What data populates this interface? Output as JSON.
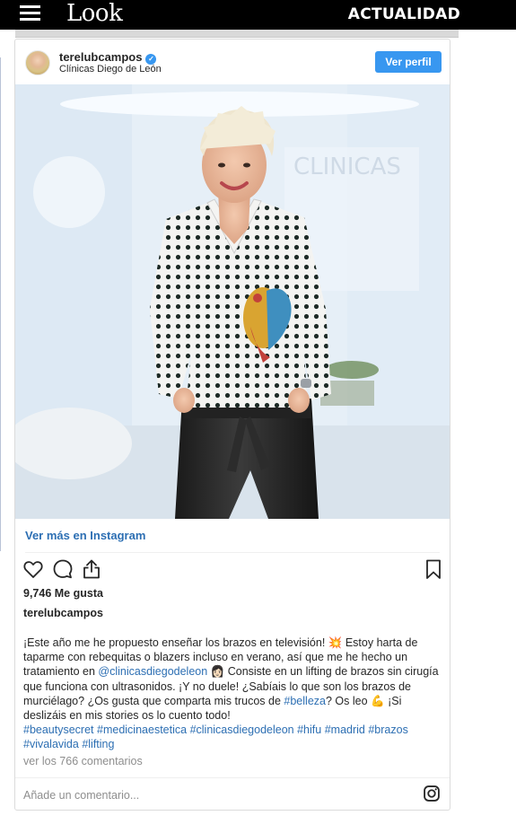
{
  "site": {
    "logo_text": "Look",
    "section": "ACTUALIDAD",
    "menu_icon": "hamburger-icon"
  },
  "post": {
    "username": "terelubcampos",
    "location": "Clínicas Diego de León",
    "profile_button": "Ver perfil",
    "view_more": "Ver más en Instagram",
    "likes": "9,746 Me gusta",
    "owner": "terelubcampos",
    "caption": {
      "p1": "¡Este año me he propuesto enseñar los brazos en televisión! ",
      "e1": "💥",
      "p2": " Estoy harta de taparme con rebequitas o blazers incluso en verano, así que me he hecho un tratamiento en ",
      "t1": "@clinicasdiegodeleon",
      "e2": "👩🏻",
      "p3": " Consiste en un lifting de brazos sin cirugía que funciona con ultrasonidos. ¡Y no duele! ¿Sabíais lo que son los brazos de murciélago? ¿Os gusta que comparta mis trucos de ",
      "t2": "#belleza",
      "p4": "? Os leo ",
      "e3": "💪",
      "p5": " ¡Si deslizáis en mis stories os lo cuento todo!",
      "h1": "#beautysecret",
      "h2": "#medicinaestetica",
      "h3": "#clinicasdiegodeleon",
      "h4": "#hifu",
      "h5": "#madrid",
      "h6": "#brazos",
      "h7": "#vivalavida",
      "h8": "#lifting"
    },
    "comments": "ver los 766 comentarios",
    "comment_placeholder": "Añade un comentario...",
    "photo_sign": "CLINICAS",
    "icons": [
      "heart-icon",
      "comment-icon",
      "share-icon",
      "bookmark-icon",
      "instagram-icon",
      "verified-badge-icon"
    ]
  },
  "colors": {
    "topbar": "#000000",
    "accent_blue": "#3897f0",
    "link_blue": "#2d6fb3",
    "logo_accent": "#e8185d"
  }
}
